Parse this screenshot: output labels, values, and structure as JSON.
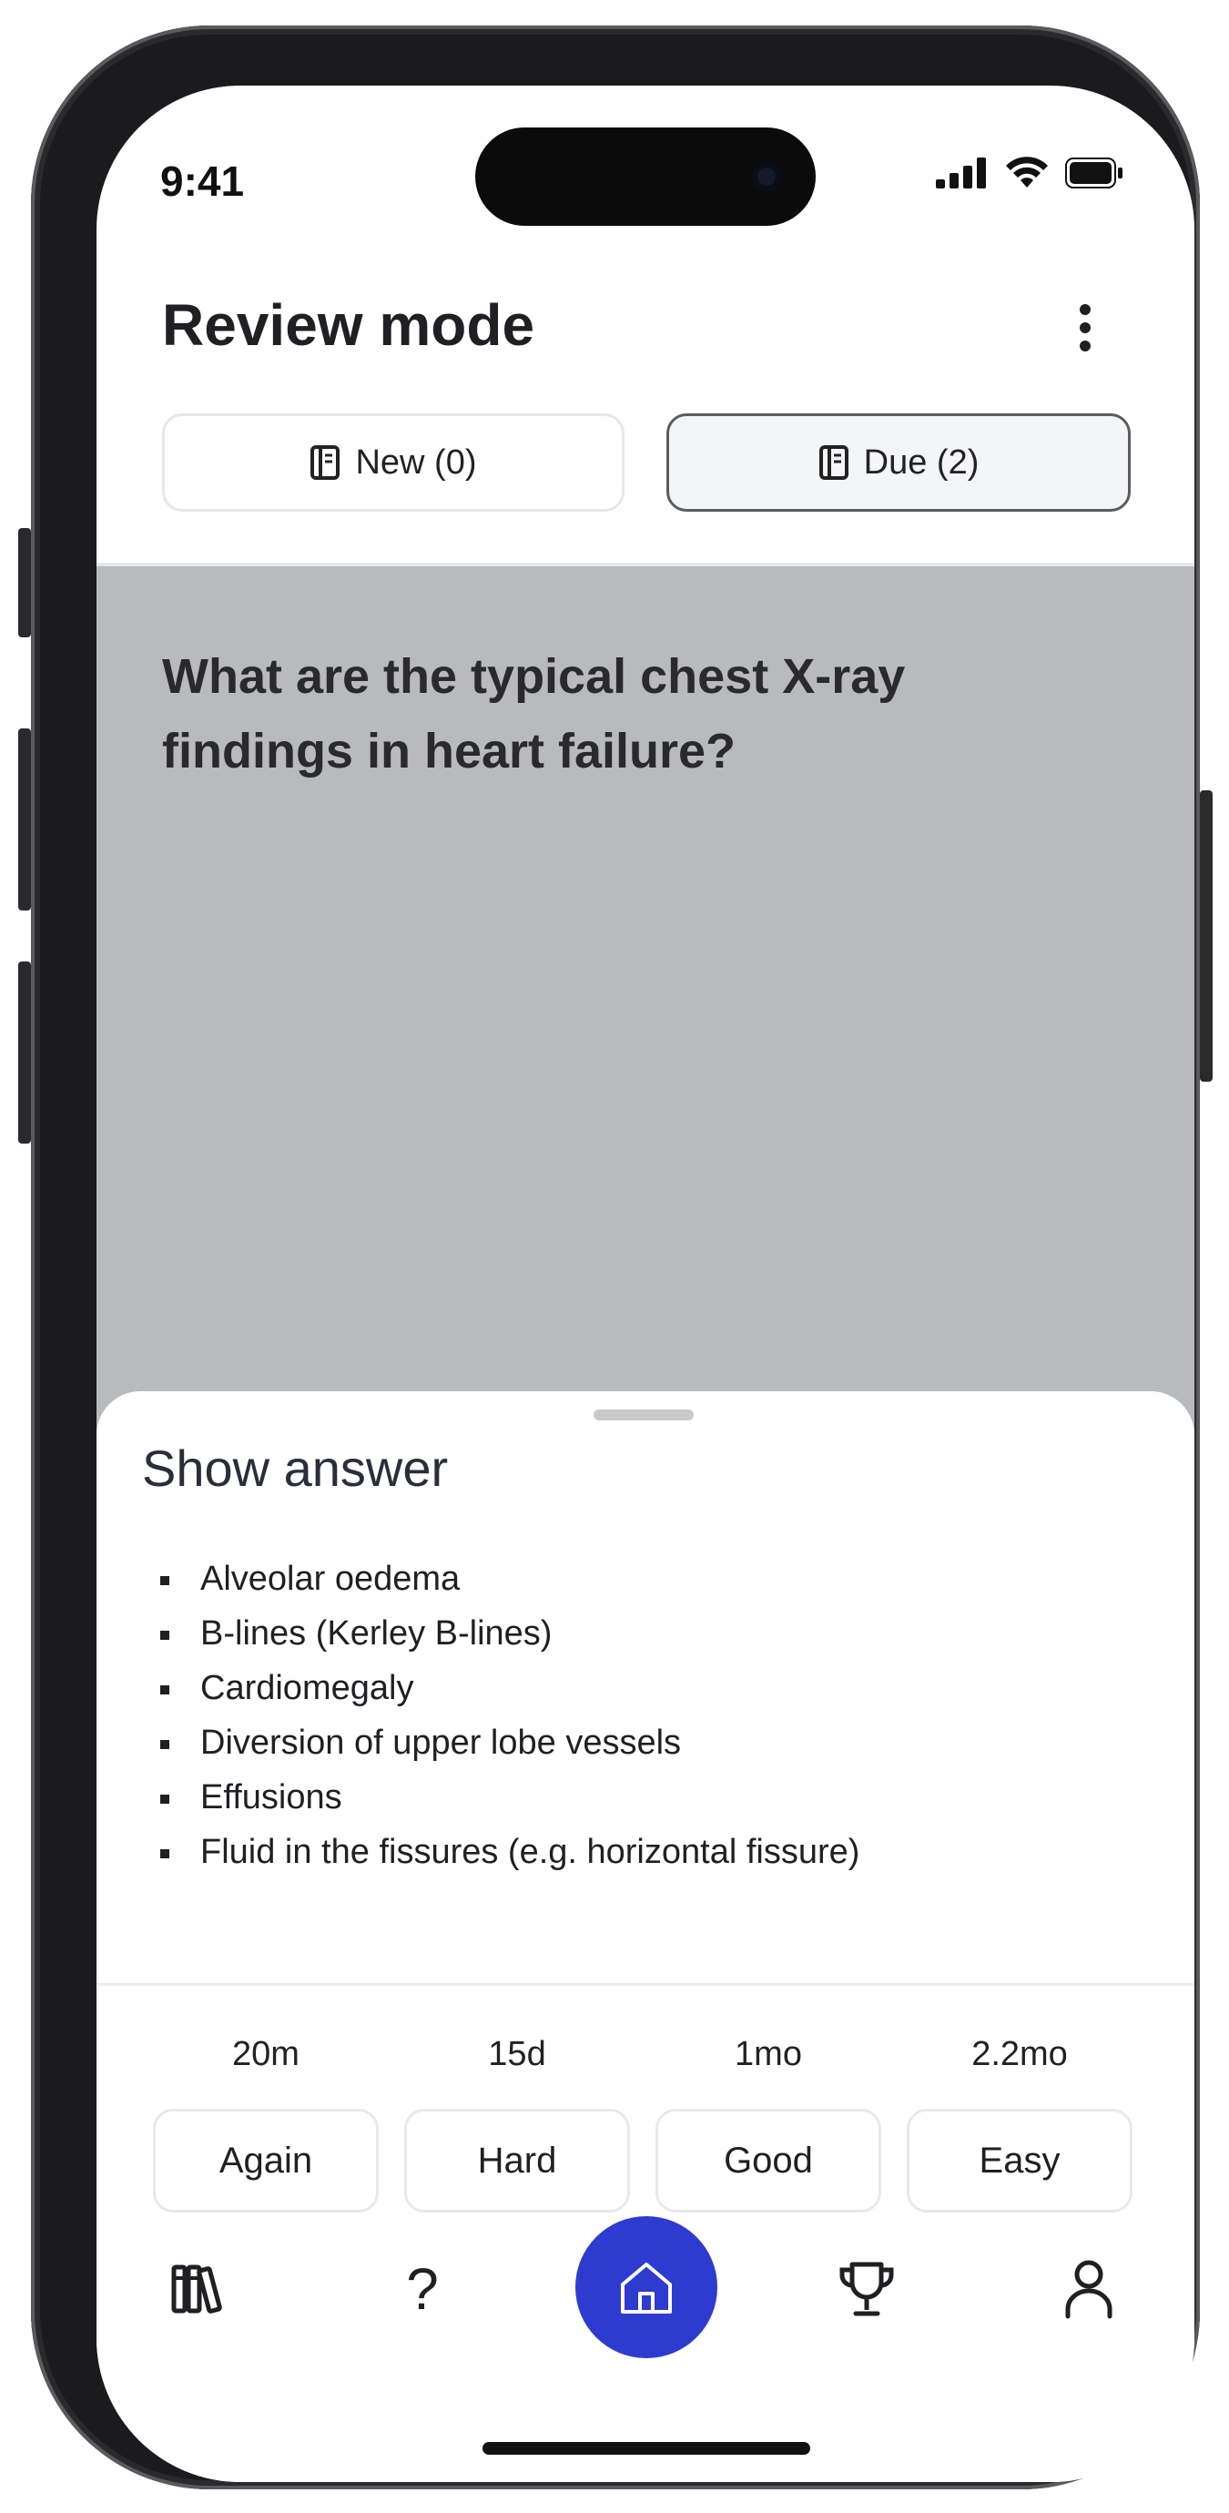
{
  "status_bar": {
    "time": "9:41"
  },
  "header": {
    "title": "Review mode"
  },
  "tabs": [
    {
      "label": "New (0)",
      "icon": "notebook-icon",
      "selected": false
    },
    {
      "label": "Due (2)",
      "icon": "notebook-icon",
      "selected": true
    }
  ],
  "card": {
    "question": "What are the typical chest X-ray findings in heart failure?"
  },
  "answer_sheet": {
    "title": "Show answer",
    "items": [
      "Alveolar oedema",
      "B-lines (Kerley B-lines)",
      "Cardiomegaly",
      "Diversion of upper lobe vessels",
      "Effusions",
      "Fluid in the fissures (e.g. horizontal fissure)"
    ]
  },
  "grading": [
    {
      "interval": "20m",
      "label": "Again"
    },
    {
      "interval": "15d",
      "label": "Hard"
    },
    {
      "interval": "1mo",
      "label": "Good"
    },
    {
      "interval": "2.2mo",
      "label": "Easy"
    }
  ],
  "bottom_nav": [
    {
      "icon": "library-icon"
    },
    {
      "icon": "help-icon",
      "glyph": "?"
    },
    {
      "icon": "home-icon",
      "active": true
    },
    {
      "icon": "trophy-icon"
    },
    {
      "icon": "profile-icon"
    }
  ],
  "colors": {
    "accent": "#2e3bd1",
    "card_background": "#b9babd"
  }
}
